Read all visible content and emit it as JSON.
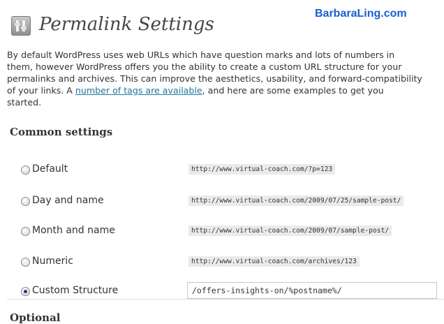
{
  "header": {
    "title": "Permalink Settings",
    "icon": "settings-icon"
  },
  "watermark": "BarbaraLing.com",
  "intro": {
    "lines": [
      "By default WordPress uses web URLs which have question marks and lots of numbers in",
      "them, however WordPress offers you the ability to create a custom URL structure for your",
      "permalinks and archives. This can improve the aesthetics, usability, and forward-compatibility"
    ],
    "line4_before_link": "of your links. A ",
    "link_text": "number of tags are available",
    "line4_after_link": ", and here are some examples to get you",
    "line5": "started."
  },
  "section_heading": "Common settings",
  "options": [
    {
      "label": "Default",
      "example": "http://www.virtual-coach.com/?p=123",
      "checked": false
    },
    {
      "label": "Day and name",
      "example": "http://www.virtual-coach.com/2009/07/25/sample-post/",
      "checked": false
    },
    {
      "label": "Month and name",
      "example": "http://www.virtual-coach.com/2009/07/sample-post/",
      "checked": false
    },
    {
      "label": "Numeric",
      "example": "http://www.virtual-coach.com/archives/123",
      "checked": false
    },
    {
      "label": "Custom Structure",
      "value": "/offers-insights-on/%postname%/",
      "checked": true
    }
  ],
  "next_heading": "Optional"
}
